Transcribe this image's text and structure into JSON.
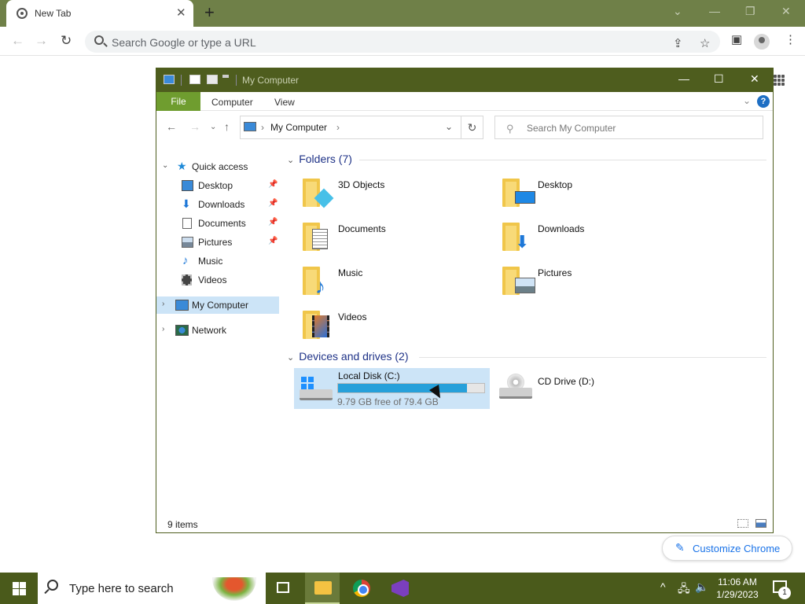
{
  "browser": {
    "tab_title": "New Tab",
    "tab_close": "✕",
    "new_tab": "+",
    "omnibox_placeholder": "Search Google or type a URL",
    "customize_label": "Customize Chrome"
  },
  "explorer": {
    "title": "My Computer",
    "ribbon_tabs": [
      "File",
      "Computer",
      "View"
    ],
    "help": "?",
    "breadcrumb": "My Computer",
    "search_placeholder": "Search My Computer",
    "nav": {
      "quick_access": "Quick access",
      "pinned": [
        "Desktop",
        "Downloads",
        "Documents",
        "Pictures"
      ],
      "unpinned": [
        "Music",
        "Videos"
      ],
      "my_computer": "My Computer",
      "network": "Network"
    },
    "folders_header": "Folders (7)",
    "folders": [
      "3D Objects",
      "Desktop",
      "Documents",
      "Downloads",
      "Music",
      "Pictures",
      "Videos"
    ],
    "devices_header": "Devices and drives (2)",
    "drives": [
      {
        "name": "Local Disk (C:)",
        "free": "9.79 GB free of 79.4 GB",
        "used_fraction": 0.88
      },
      {
        "name": "CD Drive (D:)"
      }
    ],
    "status_count": "9 items"
  },
  "taskbar": {
    "search_placeholder": "Type here to search",
    "time": "11:06 AM",
    "date": "1/29/2023",
    "notification_count": "1"
  }
}
